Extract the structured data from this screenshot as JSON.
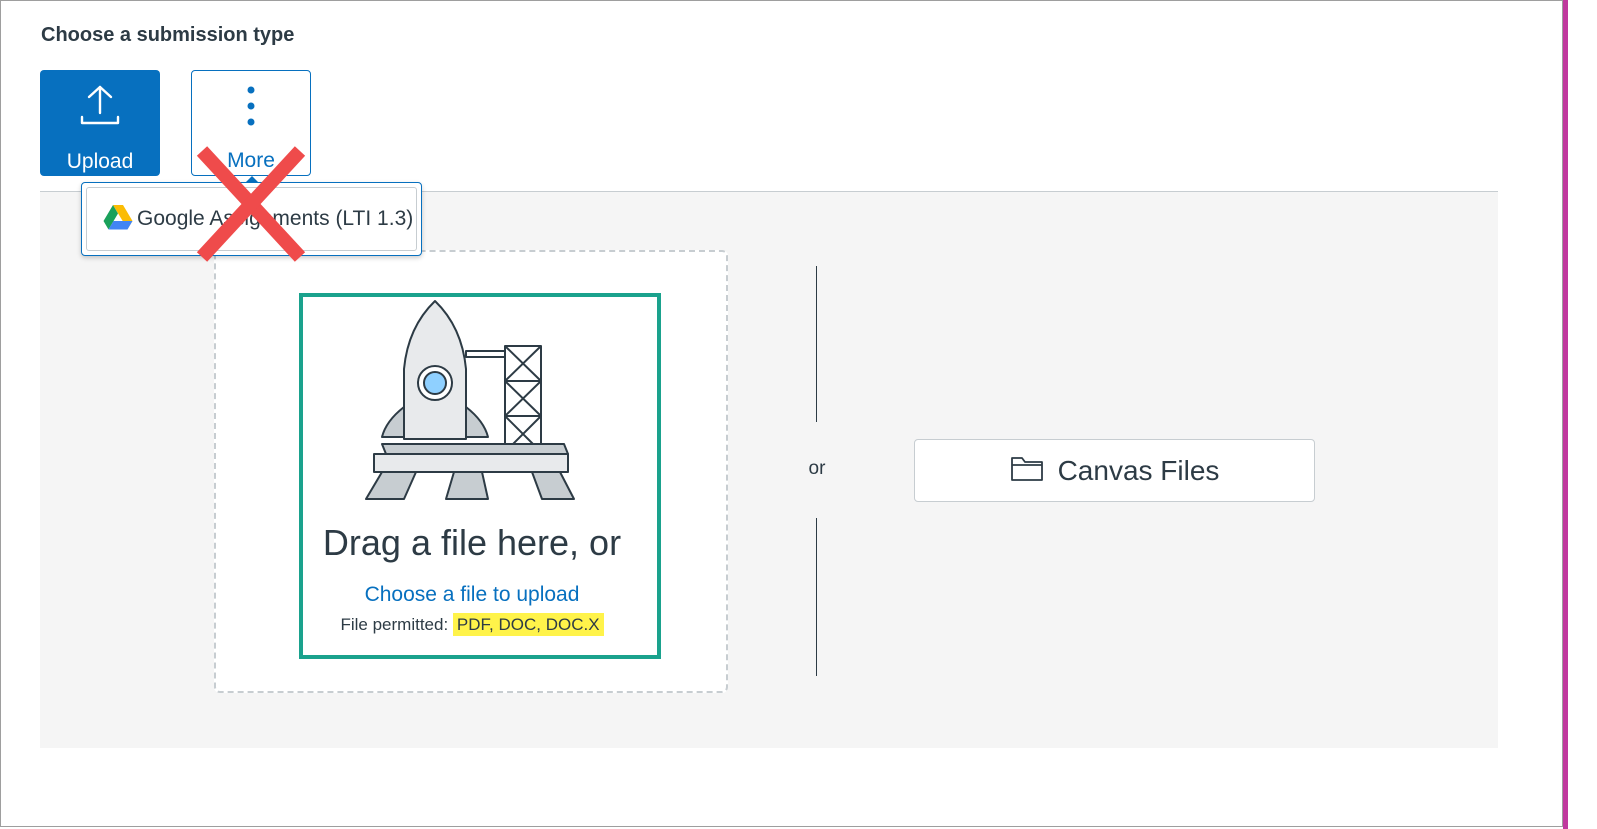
{
  "heading": "Choose a submission type",
  "submission_types": {
    "upload_label": "Upload",
    "more_label": "More"
  },
  "more_menu": {
    "items": [
      {
        "label": "Google Assignments (LTI 1.3)",
        "icon": "google-drive-icon"
      }
    ]
  },
  "dropzone": {
    "drag_text": "Drag a file here, or",
    "choose_link": "Choose a file to upload",
    "permitted_label": "File permitted:",
    "permitted_types": "PDF, DOC, DOC.X"
  },
  "or_text": "or",
  "canvas_files": {
    "label": "Canvas Files",
    "icon": "folder-icon"
  },
  "annotations": {
    "highlight_color": "#1aa28d",
    "x_mark_color": "#ef4b4b",
    "file_types_highlight": "#fff34a"
  },
  "colors": {
    "brand": "#0770bf",
    "accent_bar": "#c0399e",
    "text": "#2d3b45"
  }
}
